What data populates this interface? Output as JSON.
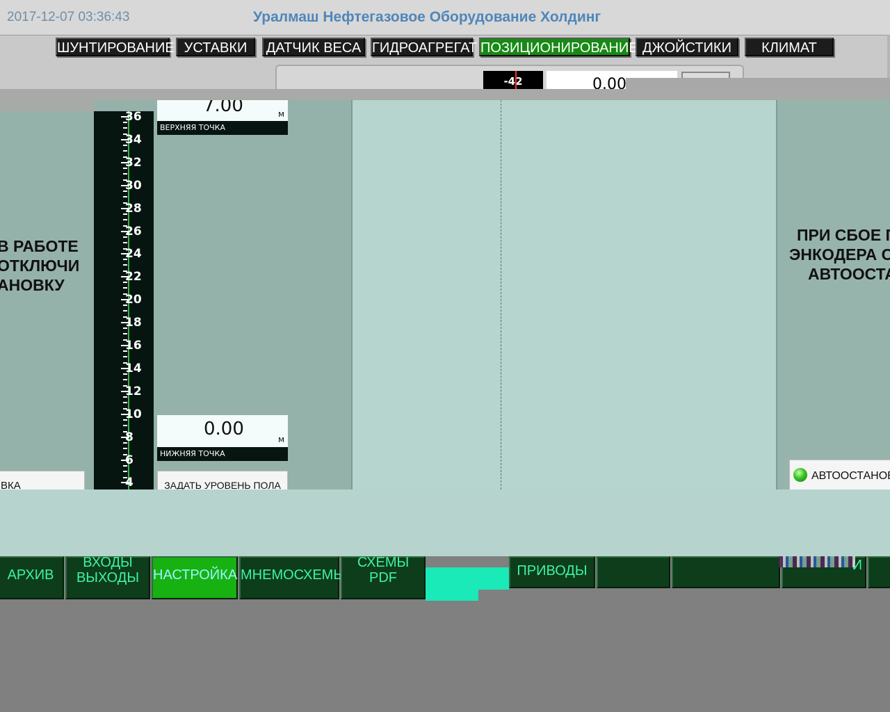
{
  "header": {
    "timestamp": "2017-12-07 03:36:43",
    "company": "Уралмаш Нефтегазовое Оборудование Холдинг"
  },
  "tabs": [
    {
      "label": "ШУНТИРОВАНИЕ",
      "active": false
    },
    {
      "label": "УСТАВКИ",
      "active": false
    },
    {
      "label": "ДАТЧИК ВЕСА",
      "active": false
    },
    {
      "label": "ГИДРОАГРЕГАТ",
      "active": false
    },
    {
      "label": "ПОЗИЦИОНИРОВАНИЕ",
      "active": true
    },
    {
      "label": "ДЖОЙСТИКИ",
      "active": false
    },
    {
      "label": "КЛИМАТ",
      "active": false
    }
  ],
  "top_panel": {
    "encoder_value": "-42",
    "position_value": "0.00"
  },
  "left_warning": [
    "В РАБОТЕ",
    "ОТКЛЮЧИ",
    "АНОВКУ"
  ],
  "left_button_label": "ВКА",
  "scale": {
    "labels": [
      "36",
      "34",
      "32",
      "30",
      "28",
      "26",
      "24",
      "22",
      "20",
      "18",
      "16",
      "14",
      "12",
      "10",
      "8",
      "6",
      "4"
    ]
  },
  "upper_point": {
    "value": "7.00",
    "unit": "м",
    "caption": "ВЕРХНЯЯ ТОЧКА"
  },
  "lower_point": {
    "value": "0.00",
    "unit": "м",
    "caption": "НИЖНЯЯ ТОЧКА"
  },
  "set_floor_button": "ЗАДАТЬ УРОВЕНЬ ПОЛА",
  "right_warning": [
    "ПРИ СБОЕ П",
    "ЭНКОДЕРА С",
    "АВТООСТА"
  ],
  "autostop_label": "АВТООСТАНОВ",
  "bottom_nav": [
    {
      "label": "АРХИВ",
      "active": false
    },
    {
      "label": "ВХОДЫ ВЫХОДЫ",
      "line1": "ВХОДЫ",
      "line2": "ВЫХОДЫ",
      "active": false
    },
    {
      "label": "НАСТРОЙКА",
      "active": true
    },
    {
      "label": "МНЕМОСХЕМЫ",
      "active": false
    },
    {
      "label": "СХЕМЫ PDF",
      "line1": "СХЕМЫ",
      "line2": "PDF",
      "active": false
    },
    {
      "label": "ПРИВОДЫ",
      "active": false
    },
    {
      "label": "",
      "active": false
    },
    {
      "label": "",
      "active": false
    },
    {
      "label": "И",
      "active": false
    },
    {
      "label": "",
      "active": false
    }
  ],
  "colors": {
    "tab_active": "#178a14",
    "nav_text": "#3ff2a6",
    "nav_active": "#17b111",
    "led": "#37c322",
    "panel": "#95b2aa",
    "header_title": "#4f86b9"
  },
  "icons": {
    "autostop_indicator": "green-led-icon"
  }
}
